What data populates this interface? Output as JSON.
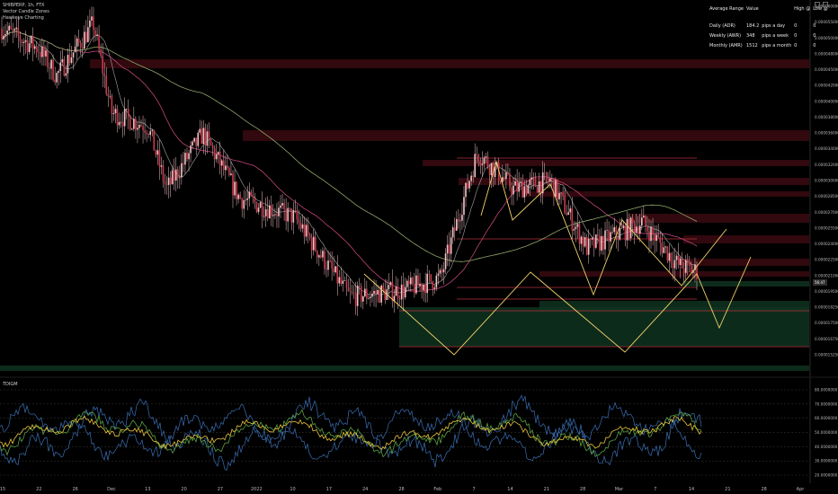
{
  "legend": {
    "symbol": "SHIBPERP, 1h, FTX",
    "indicators": [
      "Vector Candle Zones",
      "Hawkeye Charting"
    ]
  },
  "oscillator_label": "TDIGM",
  "price_badge": "56:47",
  "range_table": {
    "headers": [
      "Average Range",
      "Value",
      "",
      "High @",
      "Low @"
    ],
    "rows": [
      [
        "Daily (ADR)",
        "184.2",
        "pips a day",
        "0",
        "0"
      ],
      [
        "Weekly (AWR)",
        "348",
        "pips a week",
        "0",
        "0"
      ],
      [
        "Monthly (AMR)",
        "1512",
        "pips a month",
        "0",
        "0"
      ]
    ]
  },
  "colors": {
    "candle": "#f4c2c6",
    "zone_red": "#3a0a10",
    "zone_green": "#0f3320",
    "zigzag": "#f3d36b",
    "ma_white": "#cfcfcf",
    "ma_pink": "#c2457a",
    "ma_green": "#8fa86a",
    "osc_blue": "#3a6fb4",
    "osc_green": "#5aa043",
    "osc_yellow": "#e8c53a"
  },
  "chart_data": {
    "type": "candlestick",
    "y_axis_labels": [
      "0.0000600000",
      "0.0000550000",
      "0.0000500000",
      "0.0000480000",
      "0.0000450000",
      "0.0000420000",
      "0.0000400000",
      "0.0000380000",
      "0.0000360000",
      "0.0000340000",
      "0.0000320000",
      "0.0000300000",
      "0.0000285000",
      "0.0000270000",
      "0.0000255000",
      "0.0000240000",
      "0.0000225000",
      "0.0000210000",
      "0.0000195000",
      "0.0000182500",
      "0.0000175000",
      "0.0000167500",
      "0.0000152500"
    ],
    "x_axis_labels": [
      "15",
      "22",
      "26",
      "Dec",
      "13",
      "20",
      "27",
      "2022",
      "10",
      "17",
      "24",
      "28",
      "Feb",
      "7",
      "14",
      "21",
      "28",
      "Mar",
      "7",
      "14",
      "21",
      "28",
      "Apr"
    ],
    "price_path": [
      {
        "x": 0,
        "p": 5.5e-05
      },
      {
        "x": 2,
        "p": 5.1e-05
      },
      {
        "x": 3,
        "p": 4.6e-05
      },
      {
        "x": 5,
        "p": 5.6e-05
      },
      {
        "x": 6,
        "p": 4e-05
      },
      {
        "x": 8,
        "p": 3.8e-05
      },
      {
        "x": 9,
        "p": 3e-05
      },
      {
        "x": 11,
        "p": 3.7e-05
      },
      {
        "x": 13,
        "p": 2.9e-05
      },
      {
        "x": 16,
        "p": 2.7e-05
      },
      {
        "x": 19,
        "p": 2e-05
      },
      {
        "x": 22,
        "p": 2.05e-05
      },
      {
        "x": 24,
        "p": 2.15e-05
      },
      {
        "x": 26,
        "p": 3.45e-05
      },
      {
        "x": 28,
        "p": 3e-05
      },
      {
        "x": 30,
        "p": 3.1e-05
      },
      {
        "x": 32,
        "p": 2.4e-05
      },
      {
        "x": 35,
        "p": 2.65e-05
      },
      {
        "x": 37,
        "p": 2.25e-05
      },
      {
        "x": 38,
        "p": 2.2e-05
      }
    ],
    "oscillator": {
      "levels": [
        "80.0000000",
        "70.0000000",
        "60.0000000",
        "50.0000000",
        "40.0000000",
        "30.0000000",
        "20.0000000"
      ]
    }
  }
}
